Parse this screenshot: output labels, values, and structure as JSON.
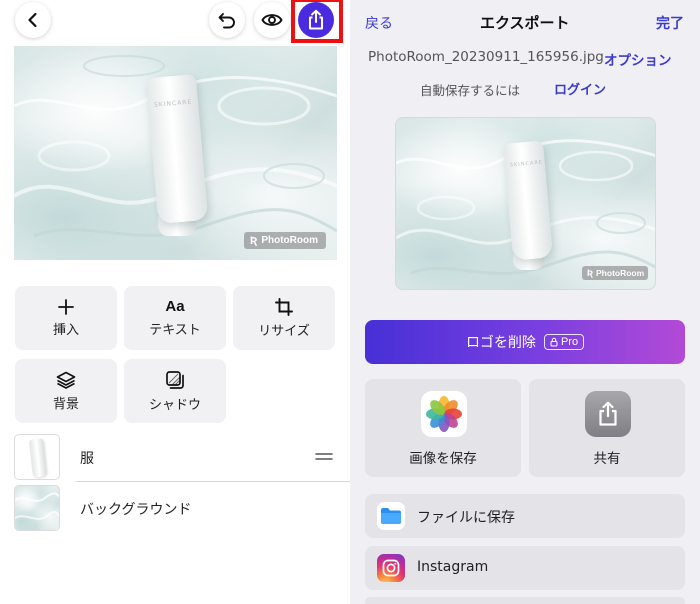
{
  "editor": {
    "tools": [
      {
        "label": "挿入",
        "icon": "plus-icon"
      },
      {
        "label": "テキスト",
        "icon": "text-aa-icon",
        "glyph": "Aa"
      },
      {
        "label": "リサイズ",
        "icon": "crop-icon"
      },
      {
        "label": "背景",
        "icon": "layers-icon"
      },
      {
        "label": "シャドウ",
        "icon": "shadow-icon"
      }
    ],
    "layers": [
      {
        "label": "服"
      },
      {
        "label": "バックグラウンド"
      }
    ],
    "product_text": "SKINCARE",
    "watermark": "PhotoRoom"
  },
  "export": {
    "back": "戻る",
    "title": "エクスポート",
    "done": "完了",
    "filename": "PhotoRoom_20230911_165956.jpg",
    "options": "オプション",
    "autosave_text": "自動保存するには",
    "login": "ログイン",
    "remove_logo": "ロゴを削除",
    "pro": "Pro",
    "save_image": "画像を保存",
    "share": "共有",
    "save_to_files": "ファイルに保存",
    "instagram": "Instagram"
  },
  "colors": {
    "accent": "#4b2be0",
    "link": "#3b3ad0",
    "highlight": "#ef1010"
  }
}
